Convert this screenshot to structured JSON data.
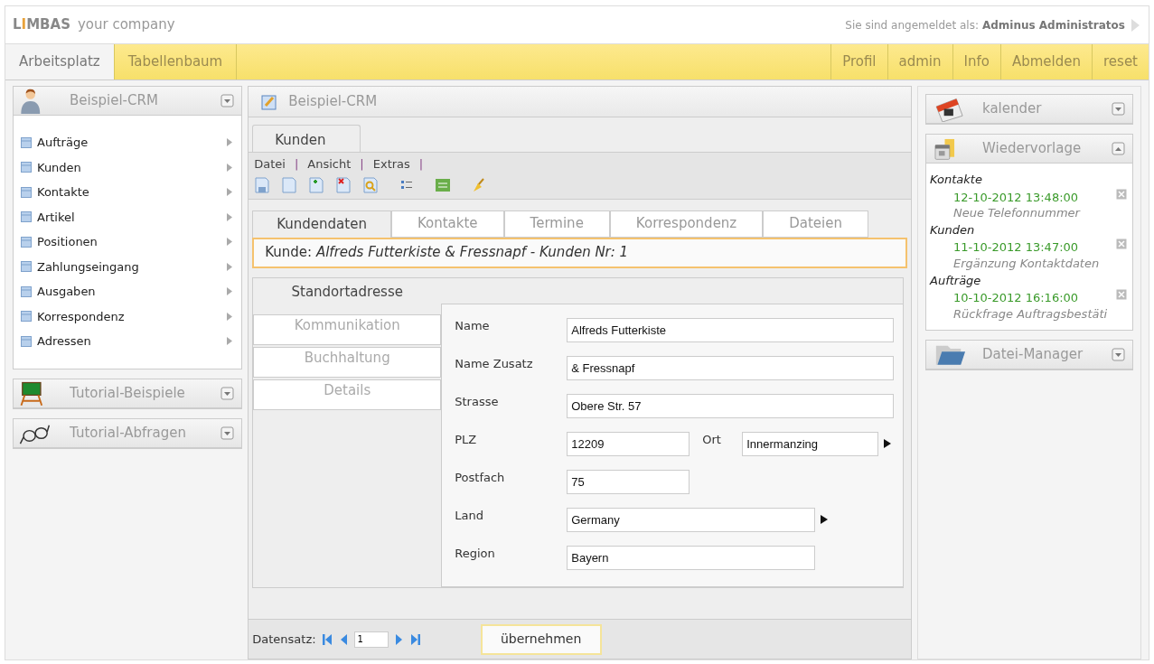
{
  "brand": {
    "logo": [
      {
        "text": "L",
        "accent": false
      },
      {
        "text": "I",
        "accent": true
      },
      {
        "text": "MBAS",
        "accent": false
      }
    ],
    "tagline": "your company"
  },
  "login": {
    "label": "Sie sind angemeldet als:",
    "user": "Adminus Administratos"
  },
  "main_tabs": [
    {
      "label": "Arbeitsplatz",
      "selected": true
    },
    {
      "label": "Tabellenbaum",
      "selected": false
    }
  ],
  "top_links": [
    "Profil",
    "admin",
    "Info",
    "Abmelden",
    "reset"
  ],
  "left_panels": [
    {
      "title": "Beispiel-CRM",
      "toggle_up": false,
      "items": [
        "Aufträge",
        "Kunden",
        "Kontakte",
        "Artikel",
        "Positionen",
        "Zahlungseingang",
        "Ausgaben",
        "Korrespondenz",
        "Adressen"
      ]
    },
    {
      "title": "Tutorial-Beispiele",
      "toggle_up": false
    },
    {
      "title": "Tutorial-Abfragen",
      "toggle_up": false
    }
  ],
  "center": {
    "title": "Beispiel-CRM",
    "table_tab": "Kunden",
    "menu": [
      {
        "label": "Datei",
        "separator": "|"
      },
      {
        "label": "Ansicht",
        "separator": "|"
      },
      {
        "label": "Extras",
        "separator": "|"
      }
    ],
    "record_tabs": [
      {
        "label": "Kundendaten",
        "selected": true
      },
      {
        "label": "Kontakte",
        "selected": false
      },
      {
        "label": "Termine",
        "selected": false
      },
      {
        "label": "Korrespondenz",
        "selected": false
      },
      {
        "label": "Dateien",
        "selected": false
      }
    ],
    "record_title": "Kunde: *Alfreds Futterkiste & Fressnapf - Kunden Nr: 1*",
    "side_tabs": [
      {
        "label": "Standortadresse",
        "selected": true
      },
      {
        "label": "Kommunikation",
        "selected": false
      },
      {
        "label": "Buchhaltung",
        "selected": false
      },
      {
        "label": "Details",
        "selected": false
      }
    ],
    "rows": [
      [
        {
          "label": "Name",
          "value": "Alfreds Futterkiste",
          "kind": "wide",
          "menu": false
        }
      ],
      [
        {
          "label": "Name Zusatz",
          "value": "& Fressnapf",
          "kind": "wide",
          "menu": false
        }
      ],
      [
        {
          "label": "Strasse",
          "value": "Obere Str. 57",
          "kind": "wide",
          "menu": false
        }
      ],
      [
        {
          "label": "PLZ",
          "value": "12209",
          "kind": "short",
          "menu": false
        },
        {
          "label": "Ort",
          "value": "Innermanzing",
          "kind": "city",
          "menu": true
        }
      ],
      [
        {
          "label": "Postfach",
          "value": "75",
          "kind": "short",
          "menu": false
        }
      ],
      [
        {
          "label": "Land",
          "value": "Germany",
          "kind": "medium",
          "menu": true
        }
      ],
      [
        {
          "label": "Region",
          "value": "Bayern",
          "kind": "medium",
          "menu": false
        }
      ]
    ],
    "footer": {
      "label": "Datensatz:",
      "record": "1",
      "button": "übernehmen"
    }
  },
  "right_panels": [
    {
      "title": "kalender",
      "toggle_up": false
    },
    {
      "title": "Wiedervorlage",
      "toggle_up": true,
      "groups": [
        {
          "name": "Kontakte",
          "entries": [
            {
              "date": "12-10-2012 13:48:00",
              "note": "Neue Telefonnummer"
            }
          ]
        },
        {
          "name": "Kunden",
          "entries": [
            {
              "date": "11-10-2012 13:47:00",
              "note": "Ergänzung Kontaktdaten"
            }
          ]
        },
        {
          "name": "Aufträge",
          "entries": [
            {
              "date": "10-10-2012 16:16:00",
              "note": "Rückfrage Auftragsbestäti"
            }
          ]
        }
      ]
    },
    {
      "title": "Datei-Manager",
      "toggle_up": false
    }
  ]
}
